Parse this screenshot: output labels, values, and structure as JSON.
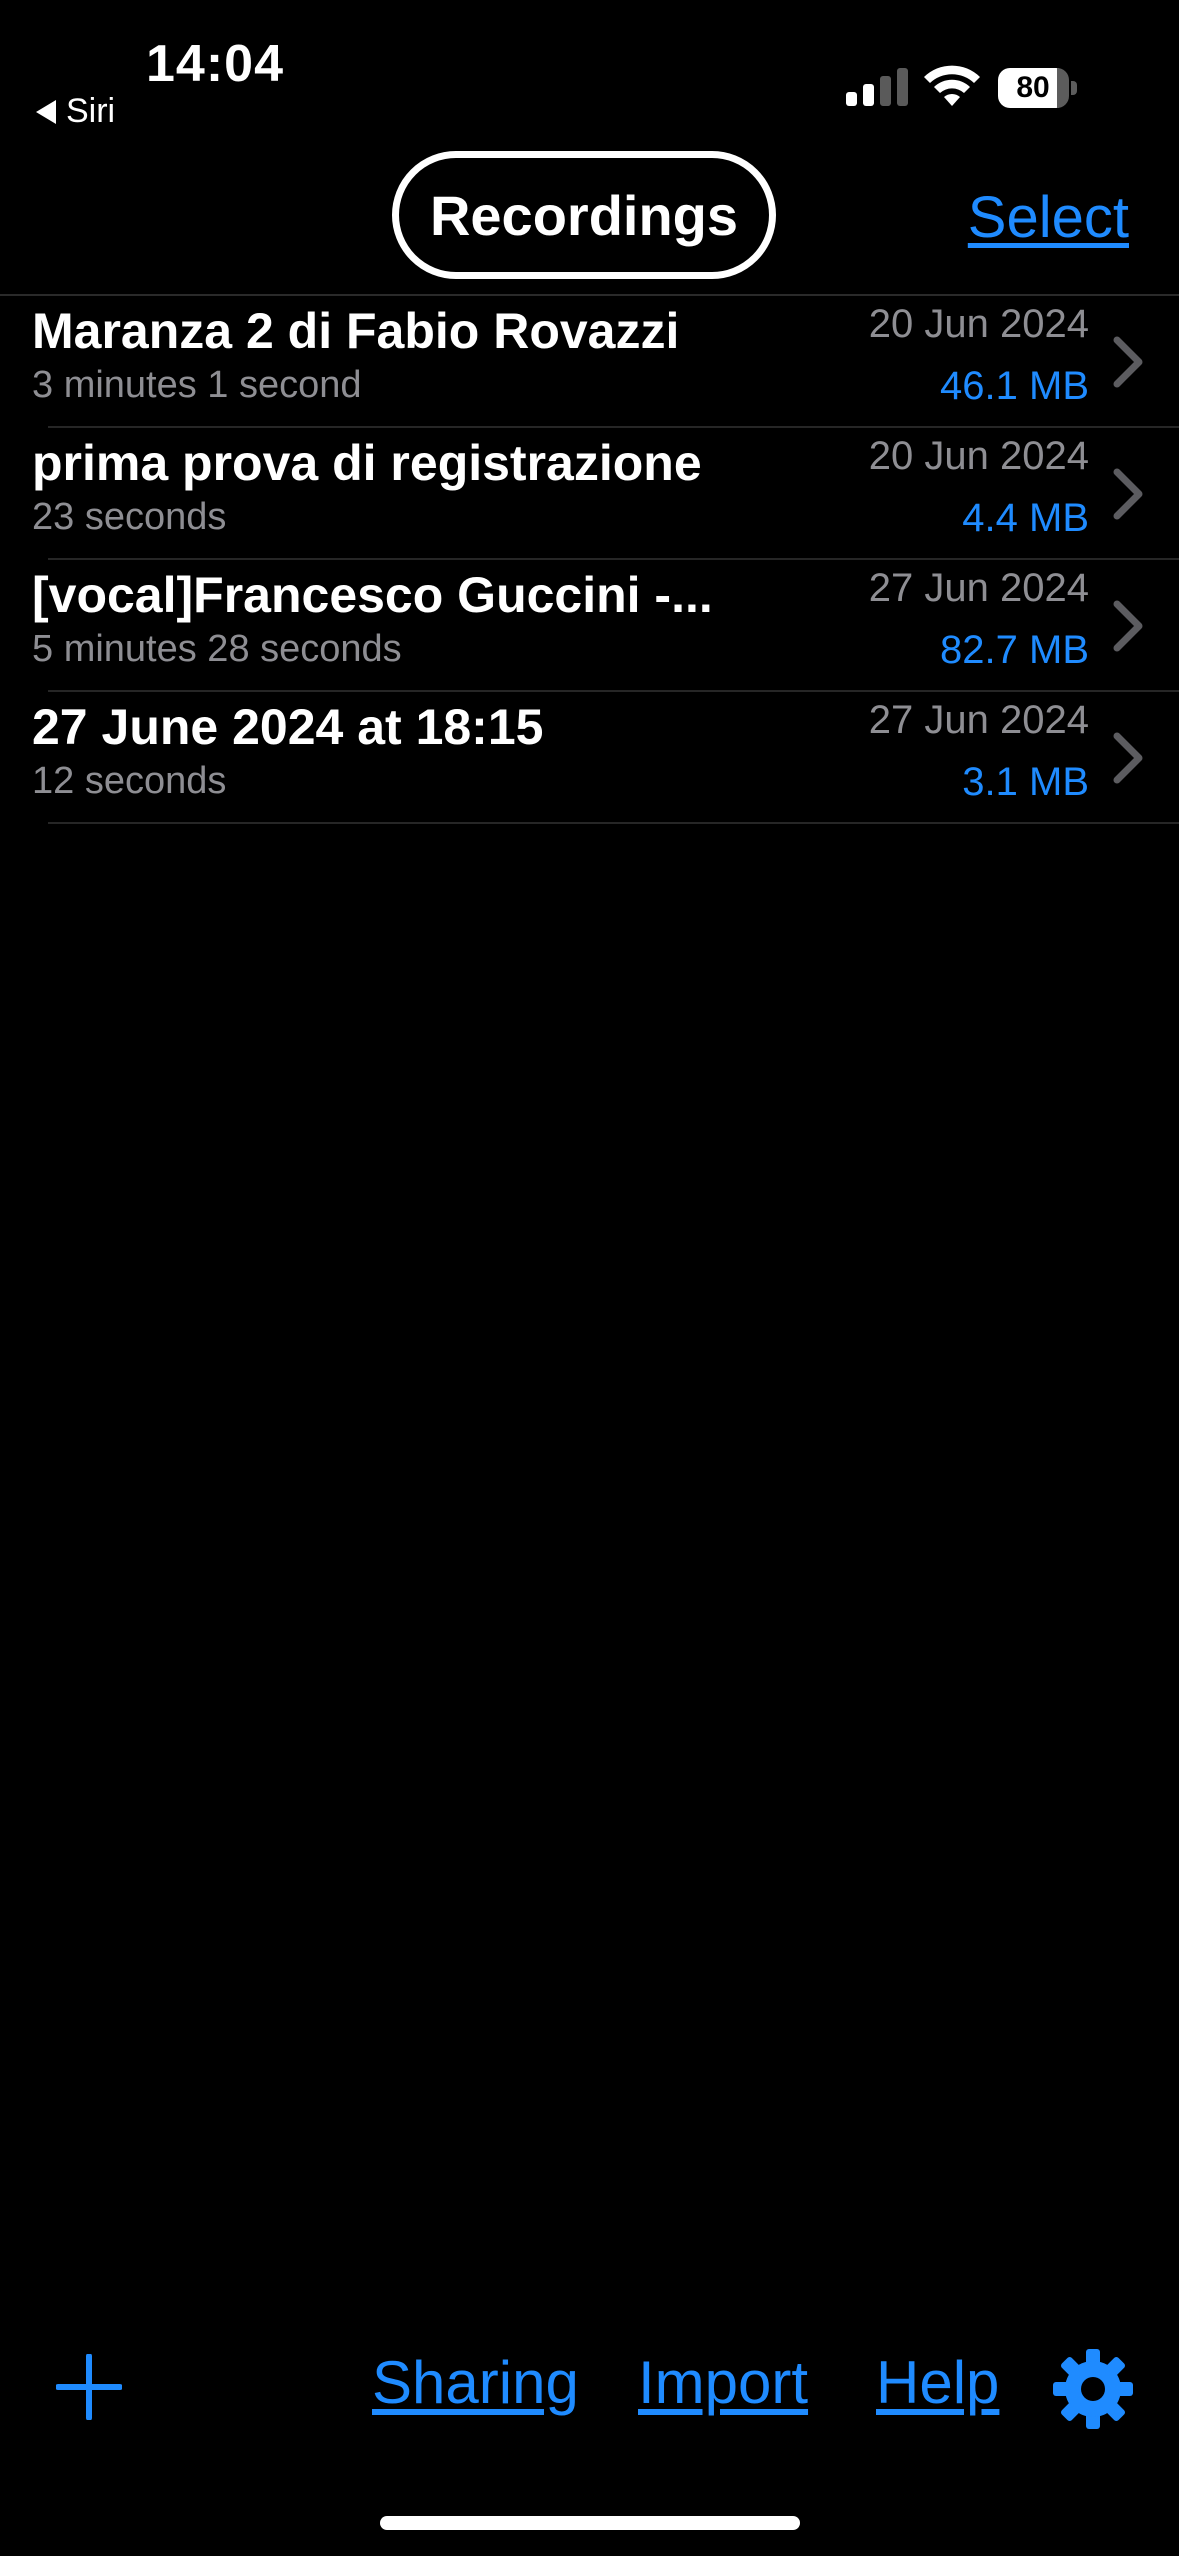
{
  "status": {
    "time": "14:04",
    "back_label": "Siri",
    "battery": "80"
  },
  "nav": {
    "title": "Recordings",
    "select_label": "Select"
  },
  "recordings": [
    {
      "title": "Maranza 2 di Fabio Rovazzi",
      "duration": "3 minutes 1 second",
      "date": "20 Jun 2024",
      "size": "46.1 MB"
    },
    {
      "title": "prima prova di registrazione",
      "duration": "23 seconds",
      "date": "20 Jun 2024",
      "size": "4.4 MB"
    },
    {
      "title": "[vocal]Francesco Guccini -...",
      "duration": "5 minutes 28 seconds",
      "date": "27 Jun 2024",
      "size": "82.7 MB"
    },
    {
      "title": "27 June 2024 at 18:15",
      "duration": "12 seconds",
      "date": "27 Jun 2024",
      "size": "3.1 MB"
    }
  ],
  "toolbar": {
    "sharing_label": "Sharing",
    "import_label": "Import",
    "help_label": "Help"
  },
  "colors": {
    "accent": "#1f8bff",
    "secondary_text": "#8e8e93",
    "background": "#000000"
  }
}
